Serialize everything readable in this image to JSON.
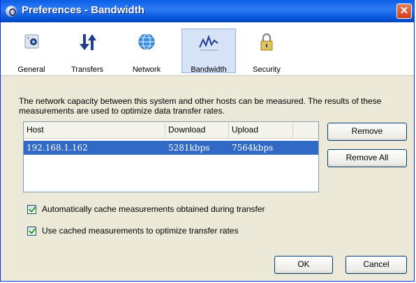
{
  "window": {
    "title": "Preferences - Bandwidth",
    "close_glyph": "✕"
  },
  "toolbar": {
    "items": [
      {
        "label": "General",
        "icon": "general-icon"
      },
      {
        "label": "Transfers",
        "icon": "transfers-icon"
      },
      {
        "label": "Network",
        "icon": "network-icon"
      },
      {
        "label": "Bandwidth",
        "icon": "bandwidth-icon",
        "selected": true
      },
      {
        "label": "Security",
        "icon": "security-icon"
      }
    ]
  },
  "bandwidth": {
    "description": "The network capacity between this system and other hosts can be measured.  The results of these measurements are used to optimize data transfer rates.",
    "table": {
      "headers": [
        "Host",
        "Download",
        "Upload"
      ],
      "rows": [
        {
          "host": "192.168.1.162",
          "download": "5281kbps",
          "upload": "7564kbps",
          "selected": true
        }
      ]
    },
    "remove_label": "Remove",
    "remove_all_label": "Remove All",
    "options": [
      {
        "label": "Automatically cache measurements obtained during transfer",
        "checked": true
      },
      {
        "label": "Use cached measurements to optimize transfer rates",
        "checked": true
      }
    ]
  },
  "footer": {
    "ok_label": "OK",
    "cancel_label": "Cancel"
  },
  "colors": {
    "title_bar": "#0a5ee8",
    "selection": "#316ac5",
    "selected_tab": "#d6e2f6",
    "close_button": "#d0401b"
  }
}
